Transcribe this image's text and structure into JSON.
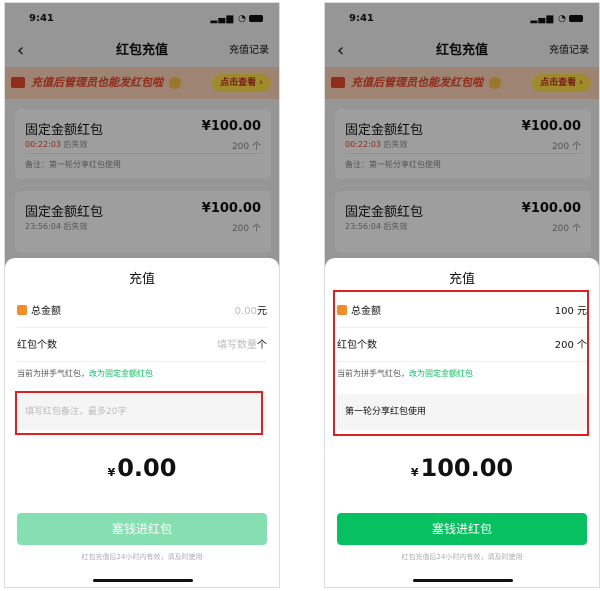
{
  "left": {
    "status_time": "9:41",
    "nav": {
      "back": "‹",
      "title": "红包充值",
      "right": "充值记录"
    },
    "banner": {
      "text": "充值后管理员也能发红包啦",
      "button": "点击查看 ›"
    },
    "cards": [
      {
        "name": "固定金额红包",
        "amount": "¥100.00",
        "countdown": "00:22:03",
        "expire_suffix": "后失效",
        "count": "200 个",
        "note": "备注：第一轮分享红包使用"
      },
      {
        "name": "固定金额红包",
        "amount": "¥100.00",
        "countdown": "23:56:04",
        "expire_suffix": "后失效",
        "count": "200 个"
      }
    ],
    "sheet": {
      "title": "充值",
      "total_label": "总金额",
      "total_value": "0.00",
      "total_unit": "元",
      "count_label": "红包个数",
      "count_placeholder": "填写数量",
      "count_unit": "个",
      "hint_text": "当前为拼手气红包，",
      "hint_link": "改为固定金额红包",
      "memo_placeholder": "填写红包备注，最多20字",
      "currency": "¥",
      "big_amount": "0.00",
      "pay_button": "塞钱进红包",
      "footer": "红包充值后24小时内有效，请及时使用"
    }
  },
  "right": {
    "status_time": "9:41",
    "nav": {
      "back": "‹",
      "title": "红包充值",
      "right": "充值记录"
    },
    "banner": {
      "text": "充值后管理员也能发红包啦",
      "button": "点击查看 ›"
    },
    "cards": [
      {
        "name": "固定金额红包",
        "amount": "¥100.00",
        "countdown": "00:22:03",
        "expire_suffix": "后失效",
        "count": "200 个",
        "note": "备注：第一轮分享红包使用"
      },
      {
        "name": "固定金额红包",
        "amount": "¥100.00",
        "countdown": "23:56:04",
        "expire_suffix": "后失效",
        "count": "200 个"
      }
    ],
    "sheet": {
      "title": "充值",
      "total_label": "总金额",
      "total_value": "100",
      "total_unit": "元",
      "count_label": "红包个数",
      "count_value": "200",
      "count_unit": "个",
      "hint_text": "当前为拼手气红包，",
      "hint_link": "改为固定金额红包",
      "memo_value": "第一轮分享红包使用",
      "currency": "¥",
      "big_amount": "100.00",
      "pay_button": "塞钱进红包",
      "footer": "红包充值后24小时内有效，请及时使用"
    }
  },
  "colors": {
    "accent_green": "#07c160",
    "disabled_green": "#86dfb0",
    "highlight_red": "#e02020",
    "banner_red": "#e8452c",
    "countdown_red": "#e8452c"
  }
}
